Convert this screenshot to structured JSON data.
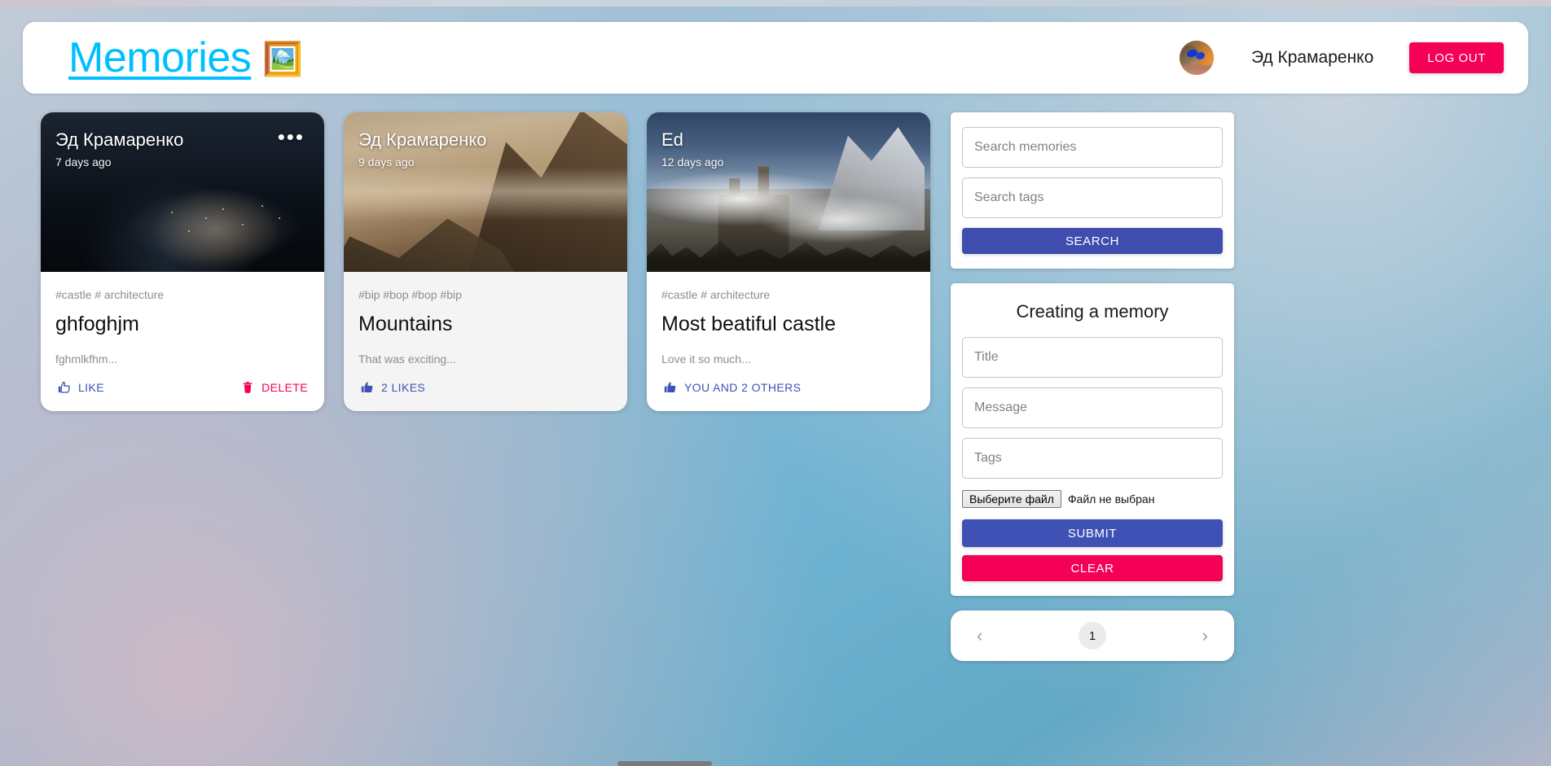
{
  "app": {
    "brand_title": "Memories",
    "brand_icon": "photo-frame-icon",
    "brand_icon_glyph": "🖼️"
  },
  "header": {
    "username": "Эд Крамаренко",
    "logout_label": "LOG OUT",
    "avatar_name": "user-avatar"
  },
  "colors": {
    "brand": "#00bfff",
    "accent_indigo": "#3f51b5",
    "accent_pink": "#f50057",
    "search_button": "#3f4eae",
    "text_muted": "#8a8d93",
    "page_background": "#72b3cf"
  },
  "posts": [
    {
      "creator": "Эд Крамаренко",
      "created_at": "7 days ago",
      "tags": "#castle # architecture",
      "title": "ghfoghjm",
      "message": "fghmlkfhm...",
      "like_label": "LIKE",
      "delete_label": "DELETE",
      "has_more_menu": true,
      "has_delete": true,
      "liked": false,
      "image_name": "night-city-aerial-photo"
    },
    {
      "creator": "Эд Крамаренко",
      "created_at": "9 days ago",
      "tags": "#bip #bop #bop #bip",
      "title": "Mountains",
      "message": "That was exciting...",
      "like_label": "2 LIKES",
      "delete_label": "",
      "has_more_menu": false,
      "has_delete": false,
      "liked": true,
      "image_name": "sepia-mountains-photo"
    },
    {
      "creator": "Ed",
      "created_at": "12 days ago",
      "tags": "#castle # architecture",
      "title": "Most beatiful castle",
      "message": "Love it so much...",
      "like_label": "YOU AND 2 OTHERS",
      "delete_label": "",
      "has_more_menu": false,
      "has_delete": false,
      "liked": true,
      "image_name": "misty-castle-mountains-photo"
    }
  ],
  "search": {
    "memories_placeholder": "Search memories",
    "memories_value": "",
    "tags_placeholder": "Search tags",
    "tags_value": "",
    "button_label": "SEARCH"
  },
  "form": {
    "heading": "Creating a memory",
    "title_placeholder": "Title",
    "title_value": "",
    "message_placeholder": "Message",
    "message_value": "",
    "tags_placeholder": "Tags",
    "tags_value": "",
    "file_button_label": "Выберите файл",
    "file_status": "Файл не выбран",
    "submit_label": "SUBMIT",
    "clear_label": "CLEAR"
  },
  "pagination": {
    "prev_glyph": "‹",
    "next_glyph": "›",
    "current_page": "1"
  }
}
